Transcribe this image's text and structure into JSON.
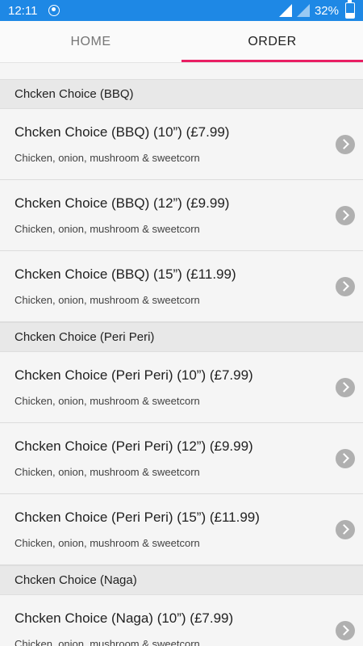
{
  "status_bar": {
    "time": "12:11",
    "battery": "32%"
  },
  "tabs": [
    {
      "label": "HOME",
      "active": false
    },
    {
      "label": "ORDER",
      "active": true
    }
  ],
  "accent_color": "#e91e63",
  "sections": [
    {
      "header": "Chcken Choice (BBQ)",
      "items": [
        {
          "title": "Chcken Choice (BBQ) (10”) (£7.99)",
          "desc": "Chicken, onion, mushroom & sweetcorn"
        },
        {
          "title": "Chcken Choice (BBQ) (12”) (£9.99)",
          "desc": "Chicken, onion, mushroom & sweetcorn"
        },
        {
          "title": "Chcken Choice (BBQ) (15”) (£11.99)",
          "desc": "Chicken, onion, mushroom & sweetcorn"
        }
      ]
    },
    {
      "header": "Chcken Choice (Peri Peri)",
      "items": [
        {
          "title": "Chcken Choice (Peri Peri) (10”) (£7.99)",
          "desc": "Chicken, onion, mushroom & sweetcorn"
        },
        {
          "title": "Chcken Choice (Peri Peri) (12”) (£9.99)",
          "desc": "Chicken, onion, mushroom & sweetcorn"
        },
        {
          "title": "Chcken Choice (Peri Peri) (15”) (£11.99)",
          "desc": "Chicken, onion, mushroom & sweetcorn"
        }
      ]
    },
    {
      "header": "Chcken Choice (Naga)",
      "items": [
        {
          "title": "Chcken Choice (Naga) (10”) (£7.99)",
          "desc": "Chicken, onion, mushroom & sweetcorn"
        }
      ]
    }
  ]
}
